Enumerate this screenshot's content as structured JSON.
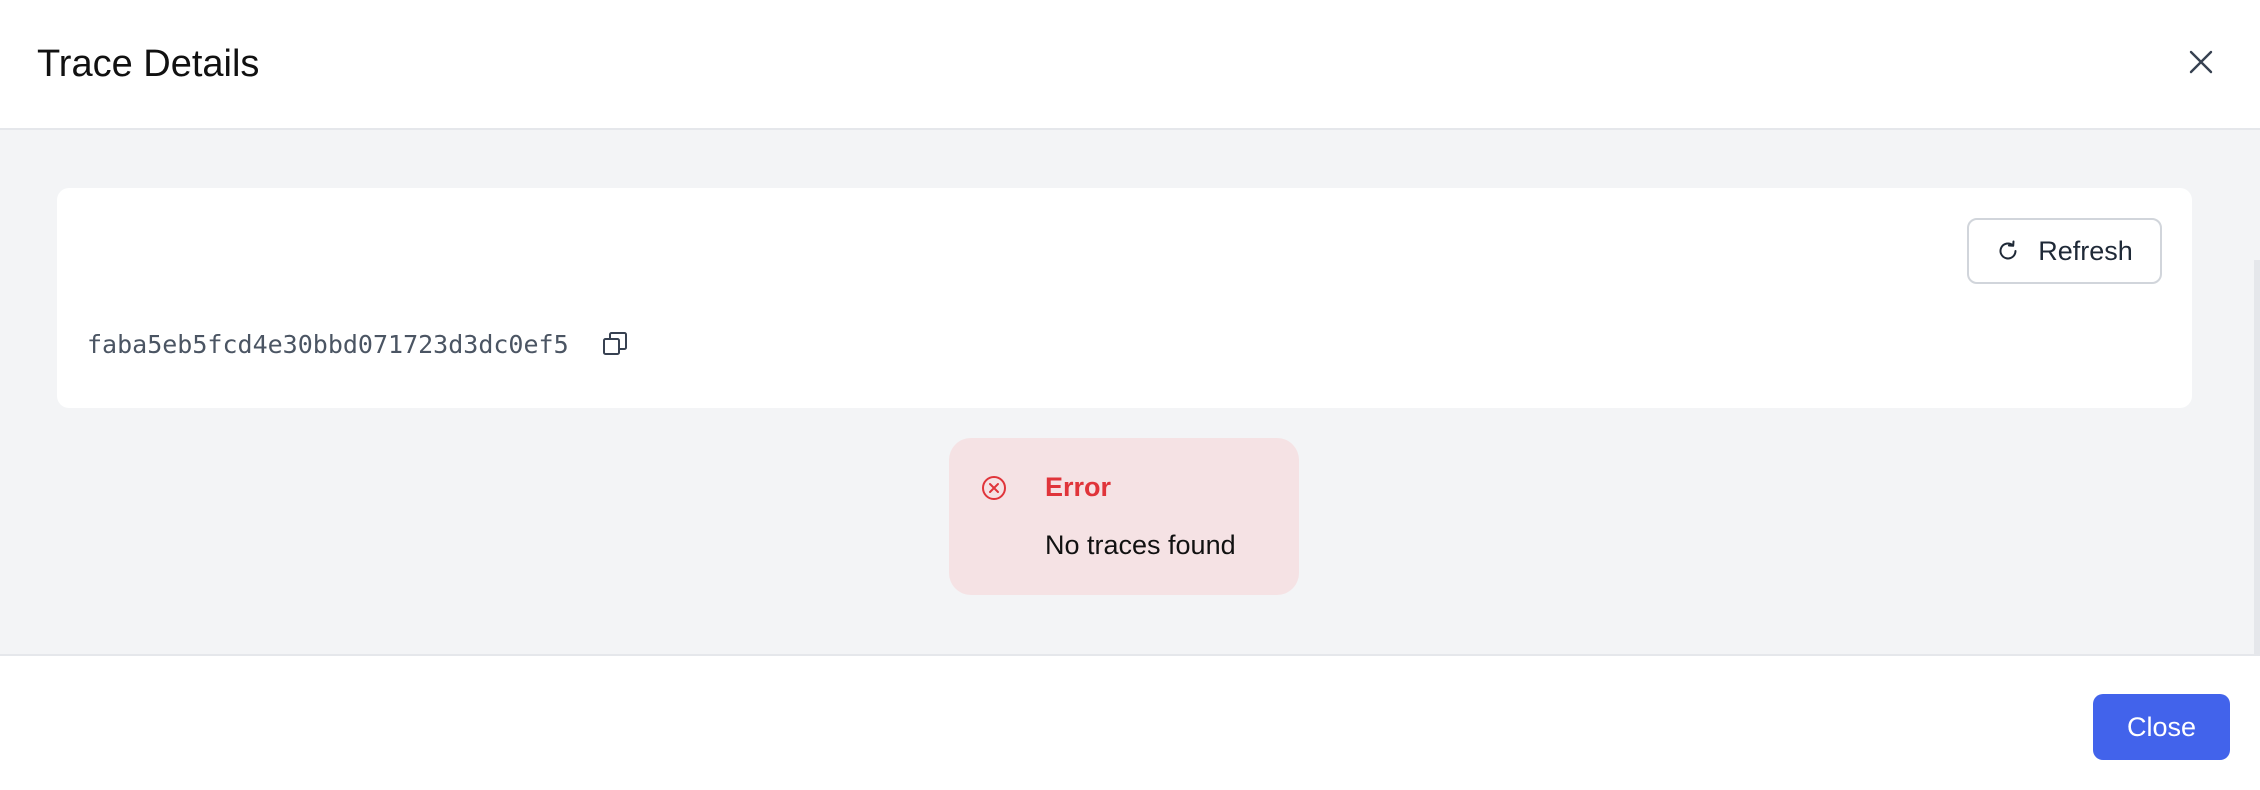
{
  "modal": {
    "title": "Trace Details",
    "close_icon": "close-icon"
  },
  "trace": {
    "refresh_label": "Refresh",
    "refresh_icon": "refresh-icon",
    "trace_id": "faba5eb5fcd4e30bbd071723d3dc0ef5",
    "copy_icon": "copy-icon"
  },
  "alert": {
    "icon": "error-circle-icon",
    "title": "Error",
    "message": "No traces found",
    "color": "#e0343a",
    "background": "#f5e2e4"
  },
  "footer": {
    "close_label": "Close",
    "accent": "#4263eb"
  }
}
